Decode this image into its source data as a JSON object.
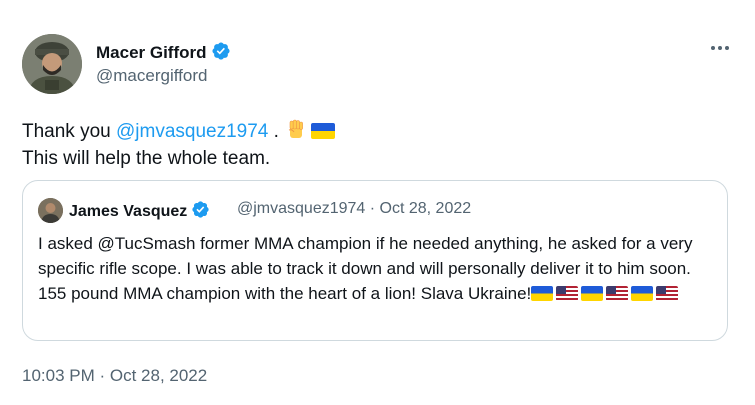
{
  "author": {
    "display_name": "Macer Gifford",
    "handle": "@macergifford",
    "verified": true
  },
  "tweet": {
    "line1_prefix": "Thank you ",
    "mention": "@jmvasquez1974",
    "line1_suffix": " .",
    "line2": "This will help the whole team.",
    "emojis": [
      "raised-fist",
      "flag-ukraine"
    ]
  },
  "quoted_tweet": {
    "display_name": "James Vasquez",
    "verified": true,
    "handle": "@jmvasquez1974",
    "separator": " · ",
    "date": "Oct 28, 2022",
    "text": "I asked @TucSmash former MMA champion if he needed anything, he asked for a very specific rifle scope. I was able to track it down and will personally deliver it to him soon. 155 pound MMA champion with the heart of a lion! Slava Ukraine!",
    "flags": [
      "ua",
      "us",
      "ua",
      "us",
      "ua",
      "us"
    ]
  },
  "timestamp": "10:03 PM · Oct 28, 2022",
  "colors": {
    "link": "#1d9bf0",
    "verified": "#1d9bf0",
    "secondary_text": "#536471",
    "border": "#cfd9de"
  }
}
